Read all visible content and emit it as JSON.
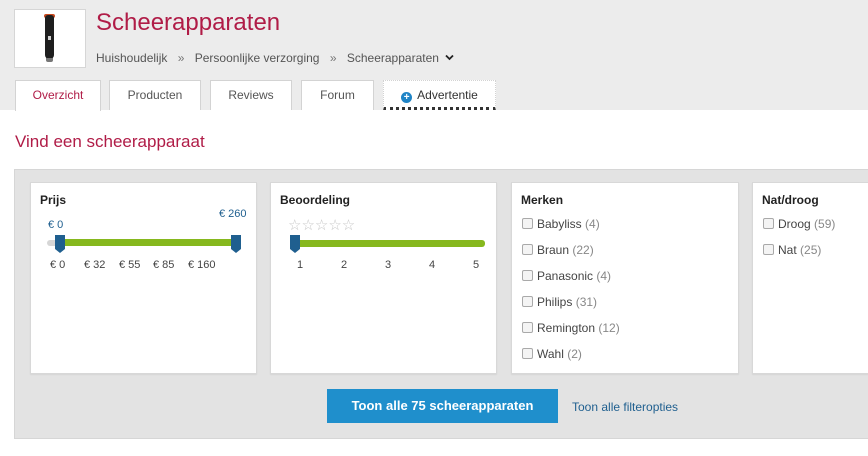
{
  "header": {
    "title": "Scheerapparaten",
    "breadcrumb": [
      "Huishoudelijk",
      "Persoonlijke verzorging",
      "Scheerapparaten"
    ],
    "breadcrumb_separator": "»",
    "product_image_icon": "shaver-product-image"
  },
  "tabs": [
    {
      "label": "Overzicht",
      "active": true
    },
    {
      "label": "Producten",
      "active": false
    },
    {
      "label": "Reviews",
      "active": false
    },
    {
      "label": "Forum",
      "active": false
    },
    {
      "label": "Advertentie",
      "active": false,
      "icon": "plus-circle-icon"
    }
  ],
  "finder": {
    "title": "Vind een scheerapparaat",
    "price": {
      "title": "Prijs",
      "min_label": "€ 0",
      "max_label": "€ 260",
      "ticks": [
        "€ 0",
        "€ 32",
        "€ 55",
        "€ 85",
        "€ 160"
      ]
    },
    "rating": {
      "title": "Beoordeling",
      "stars": "☆☆☆☆☆",
      "ticks": [
        "1",
        "2",
        "3",
        "4",
        "5"
      ]
    },
    "brands": {
      "title": "Merken",
      "items": [
        {
          "label": "Babyliss",
          "count": "(4)"
        },
        {
          "label": "Braun",
          "count": "(22)"
        },
        {
          "label": "Panasonic",
          "count": "(4)"
        },
        {
          "label": "Philips",
          "count": "(31)"
        },
        {
          "label": "Remington",
          "count": "(12)"
        },
        {
          "label": "Wahl",
          "count": "(2)"
        }
      ]
    },
    "wetdry": {
      "title": "Nat/droog",
      "items": [
        {
          "label": "Droog",
          "count": "(59)"
        },
        {
          "label": "Nat",
          "count": "(25)"
        }
      ]
    },
    "show_button": "Toon alle 75 scheerapparaten",
    "all_filters_link": "Toon alle filteropties"
  },
  "colors": {
    "brand": "#b01c47",
    "accent": "#1f8fcc",
    "slider_fill": "#86b81e",
    "slider_handle": "#1f5f8f"
  }
}
